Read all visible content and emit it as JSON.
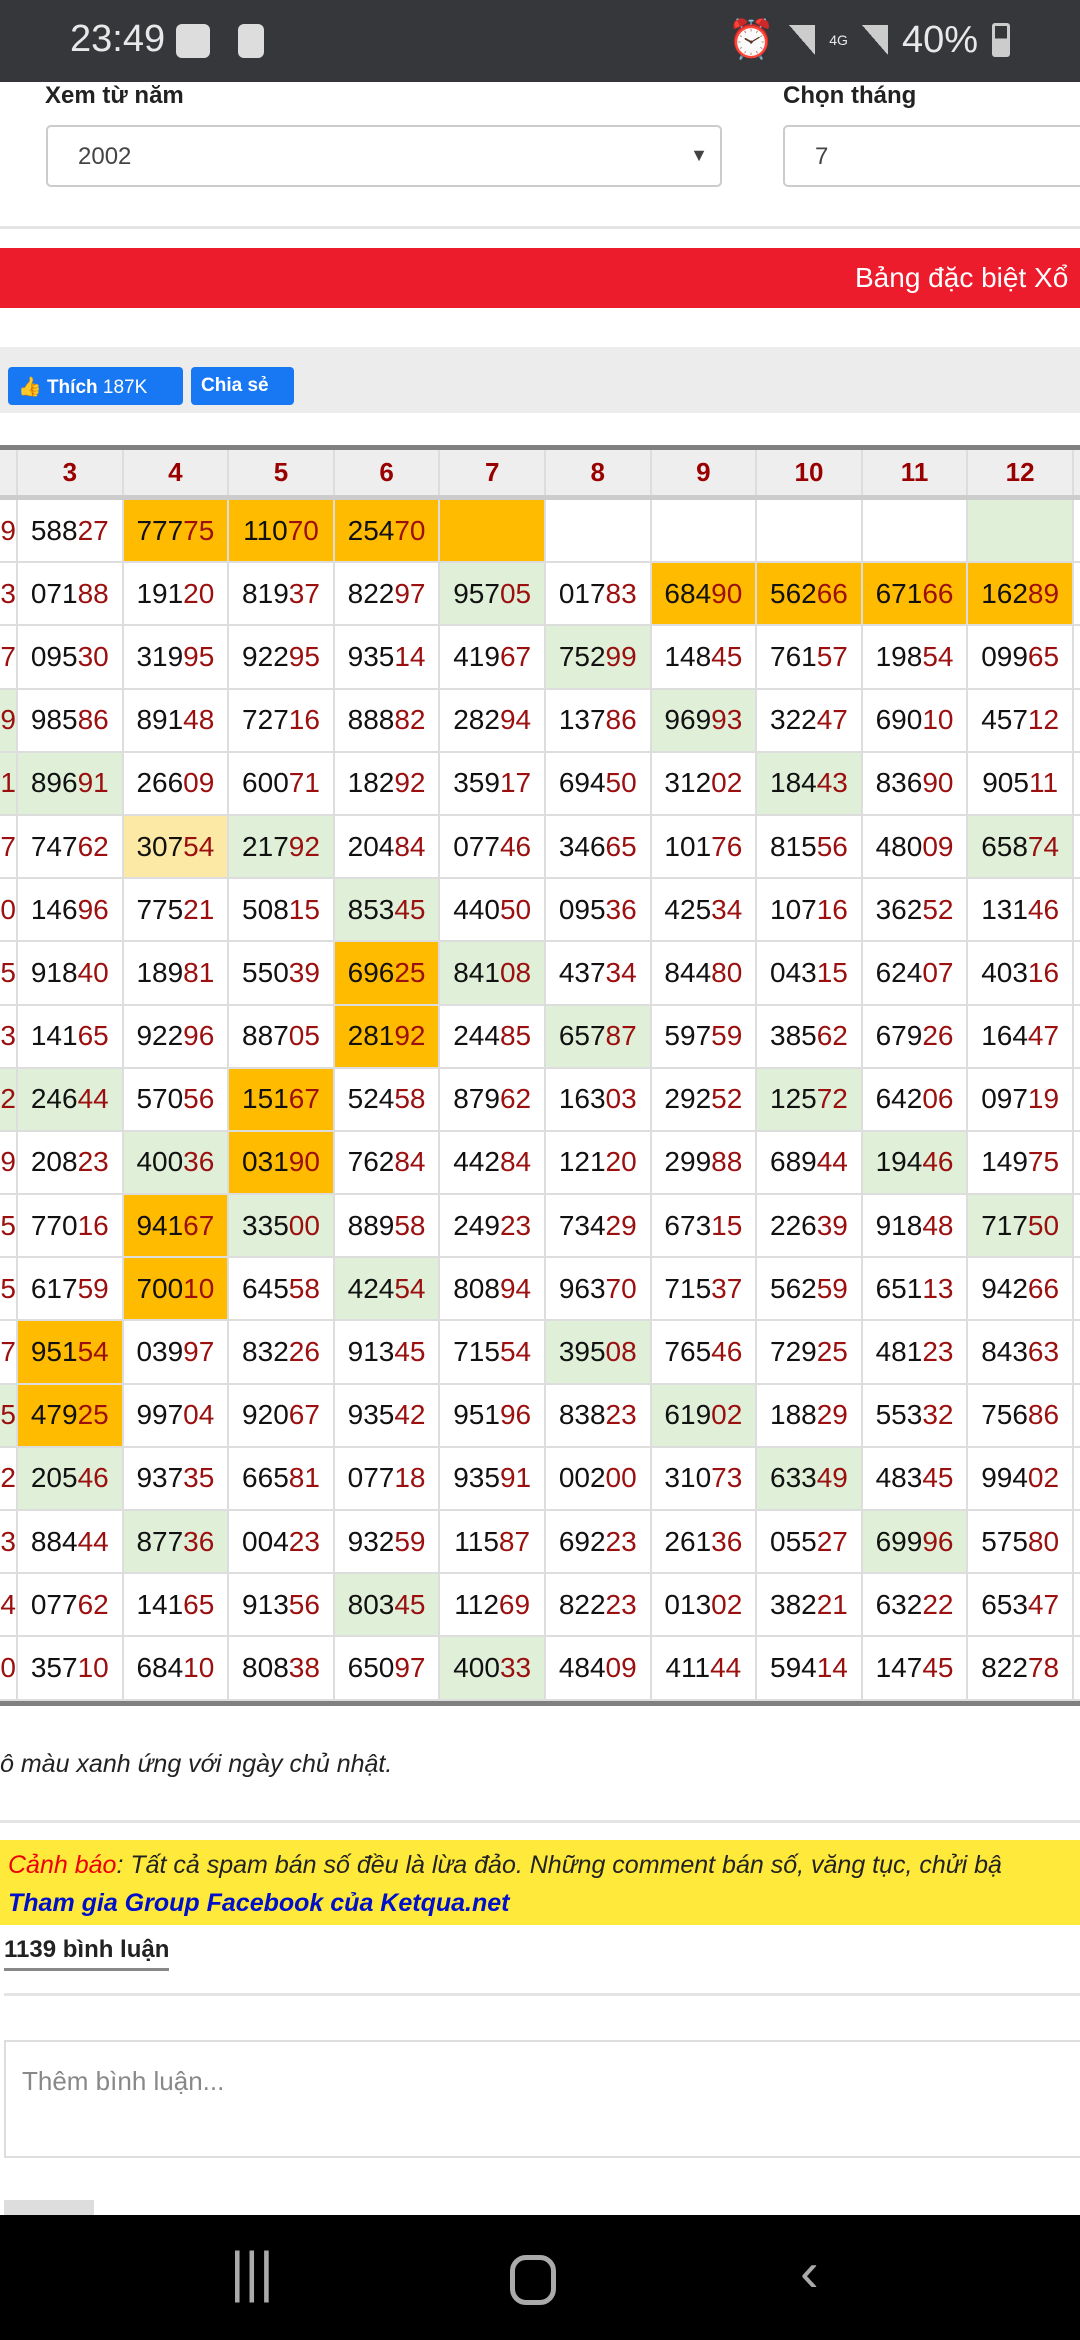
{
  "status": {
    "time": "23:49",
    "battery": "40%",
    "network": "4G"
  },
  "filters": {
    "year_label": "Xem từ năm",
    "year_value": "2002",
    "month_label": "Chọn tháng",
    "month_value": "7"
  },
  "banner": "Bảng đặc biệt Xổ",
  "social": {
    "like_label": "Thích",
    "like_count": "187K",
    "share_label": "Chia sẻ"
  },
  "table": {
    "headers": [
      "3",
      "4",
      "5",
      "6",
      "7",
      "8",
      "9",
      "10",
      "11",
      "12"
    ],
    "colors": {
      "o": "#ffbb00",
      "g": "#dfefd8",
      "y": "#fde9a6"
    },
    "rows": [
      {
        "p": "9",
        "pb": "",
        "c": [
          [
            "58827",
            ""
          ],
          [
            "77775",
            "o"
          ],
          [
            "11070",
            "o"
          ],
          [
            "25470",
            "o"
          ],
          [
            "",
            "o"
          ],
          [
            "",
            ""
          ],
          [
            "",
            ""
          ],
          [
            "",
            ""
          ],
          [
            "",
            ""
          ],
          [
            "",
            "g"
          ]
        ]
      },
      {
        "p": "3",
        "pb": "",
        "c": [
          [
            "07188",
            ""
          ],
          [
            "19120",
            ""
          ],
          [
            "81937",
            ""
          ],
          [
            "82297",
            ""
          ],
          [
            "95705",
            "g"
          ],
          [
            "01783",
            ""
          ],
          [
            "68490",
            "o"
          ],
          [
            "56266",
            "o"
          ],
          [
            "67166",
            "o"
          ],
          [
            "16289",
            "o"
          ]
        ]
      },
      {
        "p": "7",
        "pb": "",
        "c": [
          [
            "09530",
            ""
          ],
          [
            "31995",
            ""
          ],
          [
            "92295",
            ""
          ],
          [
            "93514",
            ""
          ],
          [
            "41967",
            ""
          ],
          [
            "75299",
            "g"
          ],
          [
            "14845",
            ""
          ],
          [
            "76157",
            ""
          ],
          [
            "19854",
            ""
          ],
          [
            "09965",
            ""
          ]
        ]
      },
      {
        "p": "9",
        "pb": "g",
        "c": [
          [
            "98586",
            ""
          ],
          [
            "89148",
            ""
          ],
          [
            "72716",
            ""
          ],
          [
            "88882",
            ""
          ],
          [
            "28294",
            ""
          ],
          [
            "13786",
            ""
          ],
          [
            "96993",
            "g"
          ],
          [
            "32247",
            ""
          ],
          [
            "69010",
            ""
          ],
          [
            "45712",
            ""
          ]
        ]
      },
      {
        "p": "1",
        "pb": "g",
        "c": [
          [
            "89691",
            "g"
          ],
          [
            "26609",
            ""
          ],
          [
            "60071",
            ""
          ],
          [
            "18292",
            ""
          ],
          [
            "35917",
            ""
          ],
          [
            "69450",
            ""
          ],
          [
            "31202",
            ""
          ],
          [
            "18443",
            "g"
          ],
          [
            "83690",
            ""
          ],
          [
            "90511",
            ""
          ]
        ]
      },
      {
        "p": "7",
        "pb": "",
        "c": [
          [
            "74762",
            ""
          ],
          [
            "30754",
            "y"
          ],
          [
            "21792",
            "g"
          ],
          [
            "20484",
            ""
          ],
          [
            "07746",
            ""
          ],
          [
            "34665",
            ""
          ],
          [
            "10176",
            ""
          ],
          [
            "81556",
            ""
          ],
          [
            "48009",
            ""
          ],
          [
            "65874",
            "g"
          ]
        ]
      },
      {
        "p": "0",
        "pb": "",
        "c": [
          [
            "14696",
            ""
          ],
          [
            "77521",
            ""
          ],
          [
            "50815",
            ""
          ],
          [
            "85345",
            "g"
          ],
          [
            "44050",
            ""
          ],
          [
            "09536",
            ""
          ],
          [
            "42534",
            ""
          ],
          [
            "10716",
            ""
          ],
          [
            "36252",
            ""
          ],
          [
            "13146",
            ""
          ]
        ]
      },
      {
        "p": "5",
        "pb": "",
        "c": [
          [
            "91840",
            ""
          ],
          [
            "18981",
            ""
          ],
          [
            "55039",
            ""
          ],
          [
            "69625",
            "o"
          ],
          [
            "84108",
            "g"
          ],
          [
            "43734",
            ""
          ],
          [
            "84480",
            ""
          ],
          [
            "04315",
            ""
          ],
          [
            "62407",
            ""
          ],
          [
            "40316",
            ""
          ]
        ]
      },
      {
        "p": "3",
        "pb": "",
        "c": [
          [
            "14165",
            ""
          ],
          [
            "92296",
            ""
          ],
          [
            "88705",
            ""
          ],
          [
            "28192",
            "o"
          ],
          [
            "24485",
            ""
          ],
          [
            "65787",
            "g"
          ],
          [
            "59759",
            ""
          ],
          [
            "38562",
            ""
          ],
          [
            "67926",
            ""
          ],
          [
            "16447",
            ""
          ]
        ]
      },
      {
        "p": "2",
        "pb": "g",
        "c": [
          [
            "24644",
            "g"
          ],
          [
            "57056",
            ""
          ],
          [
            "15167",
            "o"
          ],
          [
            "52458",
            ""
          ],
          [
            "87962",
            ""
          ],
          [
            "16303",
            ""
          ],
          [
            "29252",
            ""
          ],
          [
            "12572",
            "g"
          ],
          [
            "64206",
            ""
          ],
          [
            "09719",
            ""
          ]
        ]
      },
      {
        "p": "9",
        "pb": "",
        "c": [
          [
            "20823",
            ""
          ],
          [
            "40036",
            "g"
          ],
          [
            "03190",
            "o"
          ],
          [
            "76284",
            ""
          ],
          [
            "44284",
            ""
          ],
          [
            "12120",
            ""
          ],
          [
            "29988",
            ""
          ],
          [
            "68944",
            ""
          ],
          [
            "19446",
            "g"
          ],
          [
            "14975",
            ""
          ]
        ]
      },
      {
        "p": "5",
        "pb": "",
        "c": [
          [
            "77016",
            ""
          ],
          [
            "94167",
            "o"
          ],
          [
            "33500",
            "g"
          ],
          [
            "88958",
            ""
          ],
          [
            "24923",
            ""
          ],
          [
            "73429",
            ""
          ],
          [
            "67315",
            ""
          ],
          [
            "22639",
            ""
          ],
          [
            "91848",
            ""
          ],
          [
            "71750",
            "g"
          ]
        ]
      },
      {
        "p": "5",
        "pb": "",
        "c": [
          [
            "61759",
            ""
          ],
          [
            "70010",
            "o"
          ],
          [
            "64558",
            ""
          ],
          [
            "42454",
            "g"
          ],
          [
            "80894",
            ""
          ],
          [
            "96370",
            ""
          ],
          [
            "71537",
            ""
          ],
          [
            "56259",
            ""
          ],
          [
            "65113",
            ""
          ],
          [
            "94266",
            ""
          ]
        ]
      },
      {
        "p": "7",
        "pb": "",
        "c": [
          [
            "95154",
            "o"
          ],
          [
            "03997",
            ""
          ],
          [
            "83226",
            ""
          ],
          [
            "91345",
            ""
          ],
          [
            "71554",
            ""
          ],
          [
            "39508",
            "g"
          ],
          [
            "76546",
            ""
          ],
          [
            "72925",
            ""
          ],
          [
            "48123",
            ""
          ],
          [
            "84363",
            ""
          ]
        ]
      },
      {
        "p": "5",
        "pb": "g",
        "c": [
          [
            "47925",
            "o"
          ],
          [
            "99704",
            ""
          ],
          [
            "92067",
            ""
          ],
          [
            "93542",
            ""
          ],
          [
            "95196",
            ""
          ],
          [
            "83823",
            ""
          ],
          [
            "61902",
            "g"
          ],
          [
            "18829",
            ""
          ],
          [
            "55332",
            ""
          ],
          [
            "75686",
            ""
          ]
        ]
      },
      {
        "p": "2",
        "pb": "",
        "c": [
          [
            "20546",
            "g"
          ],
          [
            "93735",
            ""
          ],
          [
            "66581",
            ""
          ],
          [
            "07718",
            ""
          ],
          [
            "93591",
            ""
          ],
          [
            "00200",
            ""
          ],
          [
            "31073",
            ""
          ],
          [
            "63349",
            "g"
          ],
          [
            "48345",
            ""
          ],
          [
            "99402",
            ""
          ]
        ]
      },
      {
        "p": "3",
        "pb": "",
        "c": [
          [
            "88444",
            ""
          ],
          [
            "87736",
            "g"
          ],
          [
            "00423",
            ""
          ],
          [
            "93259",
            ""
          ],
          [
            "11587",
            ""
          ],
          [
            "69223",
            ""
          ],
          [
            "26136",
            ""
          ],
          [
            "05527",
            ""
          ],
          [
            "69996",
            "g"
          ],
          [
            "57580",
            ""
          ]
        ]
      },
      {
        "p": "4",
        "pb": "",
        "c": [
          [
            "07762",
            ""
          ],
          [
            "14165",
            ""
          ],
          [
            "91356",
            ""
          ],
          [
            "80345",
            "g"
          ],
          [
            "11269",
            ""
          ],
          [
            "82223",
            ""
          ],
          [
            "01302",
            ""
          ],
          [
            "38221",
            ""
          ],
          [
            "63222",
            ""
          ],
          [
            "65347",
            ""
          ]
        ]
      },
      {
        "p": "0",
        "pb": "",
        "c": [
          [
            "35710",
            ""
          ],
          [
            "68410",
            ""
          ],
          [
            "80838",
            ""
          ],
          [
            "65097",
            ""
          ],
          [
            "40033",
            "g"
          ],
          [
            "48409",
            ""
          ],
          [
            "41144",
            ""
          ],
          [
            "59414",
            ""
          ],
          [
            "14745",
            ""
          ],
          [
            "82278",
            ""
          ]
        ]
      }
    ]
  },
  "note": "ô màu xanh ứng với ngày chủ nhật.",
  "warning": {
    "label": "Cảnh báo",
    "text": ": Tất cả spam bán số đều là lừa đảo. Những comment bán số, văng tục, chửi bậ",
    "link": "Tham gia Group Facebook của Ketqua.net"
  },
  "comments": {
    "count": "1139 bình luận",
    "placeholder": "Thêm bình luận..."
  }
}
